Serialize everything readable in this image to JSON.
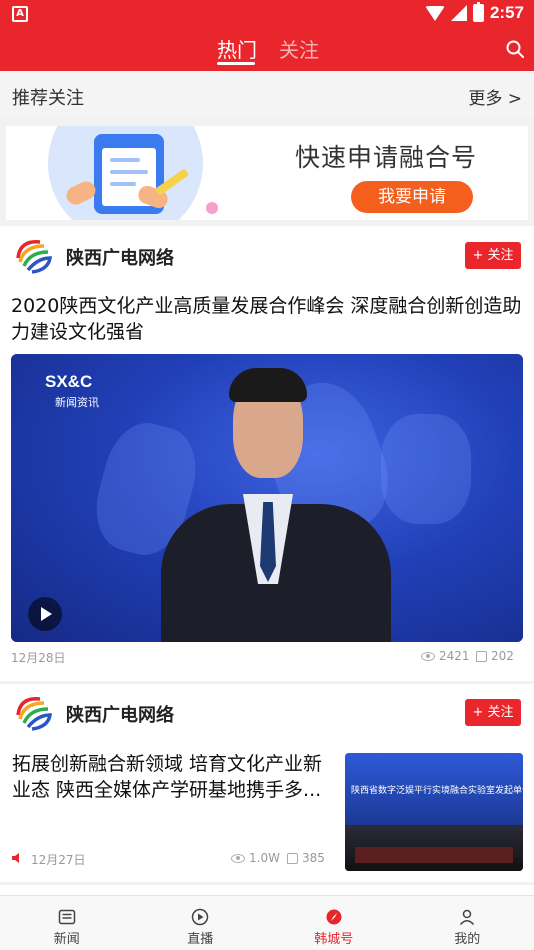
{
  "status_bar": {
    "time": "2:57",
    "left_badge": "A"
  },
  "header": {
    "tabs": [
      {
        "label": "热门",
        "active": true
      },
      {
        "label": "关注",
        "active": false
      }
    ],
    "accent_color": "#e8262b"
  },
  "recommend": {
    "title": "推荐关注",
    "more": "更多 >"
  },
  "banner": {
    "title": "快速申请融合号",
    "button": "我要申请"
  },
  "cards": [
    {
      "source": "陕西广电网络",
      "follow_label": "+ 关注",
      "headline": "2020陕西文化产业高质量发展合作峰会 深度融合创新创造助力建设文化强省",
      "video_logo": "SX&C",
      "video_logo_sub": "新闻资讯",
      "date": "12月28日",
      "views": "2421",
      "likes": "202"
    },
    {
      "source": "陕西广电网络",
      "follow_label": "+ 关注",
      "headline": "拓展创新融合新领域 培育文化产业新业态 陕西全媒体产学研基地携手多...",
      "date": "12月27日",
      "views": "1.0W",
      "likes": "385",
      "thumb_text": "陕西省数字泛娱平行实境融合实验室发起单位签约"
    }
  ],
  "bottom_nav": [
    {
      "label": "新闻",
      "icon": "news-icon",
      "active": false
    },
    {
      "label": "直播",
      "icon": "play-circle-icon",
      "active": false
    },
    {
      "label": "韩城号",
      "icon": "compass-icon",
      "active": true
    },
    {
      "label": "我的",
      "icon": "user-icon",
      "active": false
    }
  ]
}
